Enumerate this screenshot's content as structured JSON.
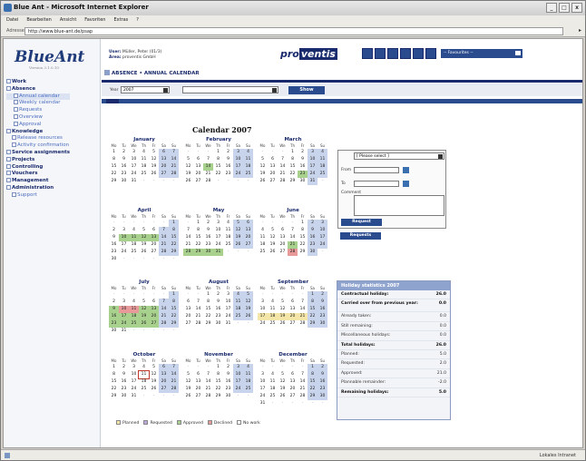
{
  "browser": {
    "title": "Blue Ant - Microsoft Internet Explorer",
    "menu": [
      "Datei",
      "Bearbeiten",
      "Ansicht",
      "Favoriten",
      "Extras",
      "?"
    ],
    "address_label": "Adresse",
    "address": "http://www.blue-ant.de/psap",
    "status_zone": "Lokales Intranet"
  },
  "app": {
    "logo": "BlueAnt",
    "version": "Version 3.1.0.10",
    "user_label": "User:",
    "user": "Müller, Peter (01/3)",
    "area_label": "Area:",
    "area": "proventis GmbH",
    "brand_pre": "pro",
    "brand_post": "ventis",
    "favourites": "-- Favourites --",
    "breadcrumb": "ABSENCE • ANNUAL CALENDAR"
  },
  "sidebar": {
    "items": [
      {
        "label": "Work",
        "type": "top"
      },
      {
        "label": "Absence",
        "type": "top"
      },
      {
        "label": "Annual calendar",
        "type": "sub",
        "selected": true
      },
      {
        "label": "Weekly calendar",
        "type": "sub"
      },
      {
        "label": "Requests",
        "type": "sub"
      },
      {
        "label": "Overview",
        "type": "sub"
      },
      {
        "label": "Approval",
        "type": "sub"
      },
      {
        "label": "Knowledge",
        "type": "top"
      },
      {
        "label": "Release resources",
        "type": "sub2"
      },
      {
        "label": "Activity confirmation",
        "type": "sub2"
      },
      {
        "label": "Service assignments",
        "type": "top"
      },
      {
        "label": "Projects",
        "type": "top"
      },
      {
        "label": "Controlling",
        "type": "top"
      },
      {
        "label": "Vouchers",
        "type": "top"
      },
      {
        "label": "Management",
        "type": "top"
      },
      {
        "label": "Administration",
        "type": "top"
      },
      {
        "label": "Support",
        "type": "sub2"
      }
    ]
  },
  "filter": {
    "year_label": "Year",
    "year_value": "2007",
    "show_label": "Show"
  },
  "calendar": {
    "title": "Calendar 2007",
    "day_headers": [
      "Mo",
      "Tu",
      "We",
      "Th",
      "Fr",
      "Sa",
      "Su"
    ],
    "months": [
      {
        "name": "January",
        "offset": 0,
        "days": 31
      },
      {
        "name": "February",
        "offset": 3,
        "days": 28
      },
      {
        "name": "March",
        "offset": 3,
        "days": 31
      },
      {
        "name": "April",
        "offset": 6,
        "days": 30
      },
      {
        "name": "May",
        "offset": 1,
        "days": 31
      },
      {
        "name": "June",
        "offset": 4,
        "days": 30
      },
      {
        "name": "July",
        "offset": 6,
        "days": 31
      },
      {
        "name": "August",
        "offset": 2,
        "days": 31
      },
      {
        "name": "September",
        "offset": 5,
        "days": 30
      },
      {
        "name": "October",
        "offset": 0,
        "days": 31
      },
      {
        "name": "November",
        "offset": 3,
        "days": 30
      },
      {
        "name": "December",
        "offset": 5,
        "days": 31
      }
    ],
    "colors": {
      "weekend": "#c8d4ec",
      "approved": "#a9d18e",
      "declined": "#e89a9a",
      "planned": "#f3e6a8",
      "today_border": "#c0392b"
    },
    "approved": {
      "April": [
        10,
        11,
        12,
        13
      ],
      "May": [
        28,
        29,
        30,
        31
      ],
      "July": [
        9,
        10,
        11,
        12,
        13,
        16,
        17,
        18,
        19,
        20,
        23,
        24,
        25,
        26,
        27
      ],
      "March": [
        23
      ],
      "June": [
        21
      ],
      "February": [
        14
      ]
    },
    "declined": {
      "June": [
        28
      ],
      "July": [
        10,
        11
      ]
    },
    "planned": {
      "September": [
        17,
        18,
        19,
        20,
        21
      ]
    },
    "today": {
      "October": 11
    }
  },
  "request_form": {
    "select_placeholder": "[ Please select ]",
    "from_label": "From",
    "to_label": "To",
    "comment_label": "Comment",
    "request_btn": "Request",
    "requests_btn": "Requests"
  },
  "stats": {
    "title": "Holiday statistics 2007",
    "rows": [
      {
        "label": "Contractual holiday:",
        "value": "26.0",
        "bold": true
      },
      {
        "label": "Carried over from previous year:",
        "value": "0.0",
        "bold": true,
        "tall": true
      },
      {
        "label": "Already taken:",
        "value": "0.0"
      },
      {
        "label": "Still remaining:",
        "value": "0.0"
      },
      {
        "label": "Miscellaneous holidays:",
        "value": "0.0"
      },
      {
        "label": "Total holidays:",
        "value": "26.0",
        "bold": true
      },
      {
        "label": "Planned:",
        "value": "5.0"
      },
      {
        "label": "Requested:",
        "value": "2.0"
      },
      {
        "label": "Approved:",
        "value": "21.0"
      },
      {
        "label": "Plannable remainder:",
        "value": "-2.0"
      },
      {
        "label": "Remaining holidays:",
        "value": "5.0",
        "bold": true
      }
    ]
  },
  "legend": [
    {
      "label": "Planned",
      "color": "#f3e6a8"
    },
    {
      "label": "Requested",
      "color": "#b9a8d9"
    },
    {
      "label": "Approved",
      "color": "#a9d18e"
    },
    {
      "label": "Declined",
      "color": "#e89a9a"
    },
    {
      "label": "No work",
      "color": "#ffffff"
    }
  ]
}
